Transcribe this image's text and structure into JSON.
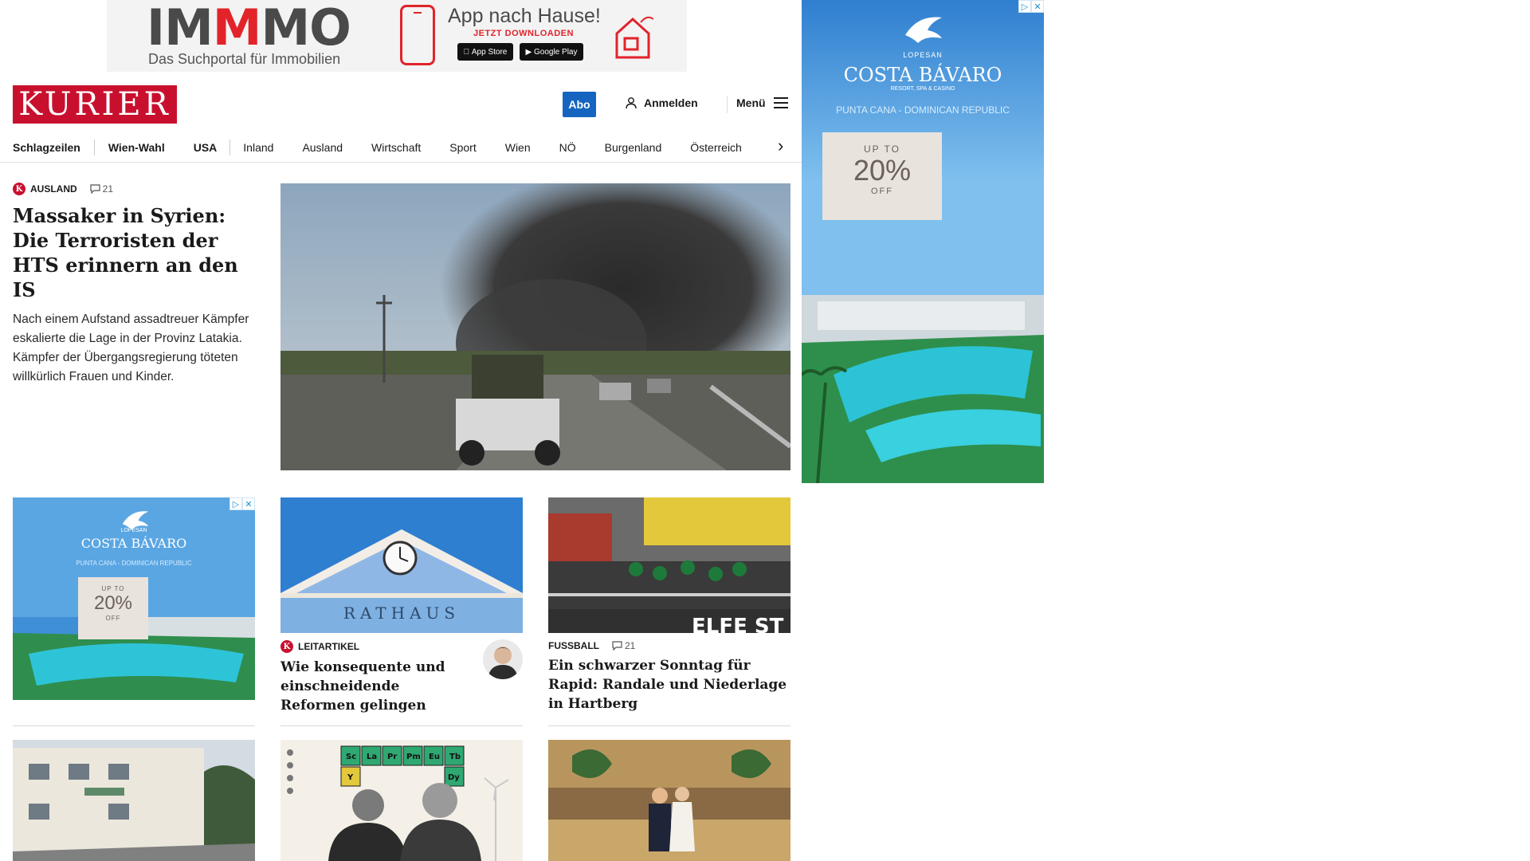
{
  "top_ad": {
    "brand_parts": [
      "IM",
      "M",
      "MO"
    ],
    "tagline": "Das Suchportal für Immobilien",
    "headline": "App nach Hause!",
    "cta": "JETZT DOWNLOADEN",
    "app_store": "App Store",
    "google_play": "Google Play"
  },
  "header": {
    "logo": "KURIER",
    "abo": "Abo",
    "login": "Anmelden",
    "menu": "Menü"
  },
  "nav": {
    "items": [
      "Schlagzeilen",
      "Wien-Wahl",
      "USA",
      "Inland",
      "Ausland",
      "Wirtschaft",
      "Sport",
      "Wien",
      "NÖ",
      "Burgenland",
      "Österreich"
    ]
  },
  "lead": {
    "badge": "K",
    "section": "Ausland",
    "comments": "21",
    "title": "Massaker in Syrien: Die Terroristen der HTS erinnern an den IS",
    "teaser": "Nach einem Aufstand assadtreuer Kämpfer eskalierte die Lage in der Provinz Latakia. Kämpfer der Übergangsregierung töteten willkürlich Frauen und Kinder."
  },
  "ad": {
    "brand_small": "LOPESAN",
    "brand": "COSTA BÁVARO",
    "sub": "RESORT, SPA & CASINO",
    "location": "PUNTA CANA - DOMINICAN REPUBLIC",
    "up_to": "UP TO",
    "discount": "20%",
    "off": "OFF"
  },
  "cards": [
    {
      "badge": "K",
      "section": "Leitartikel",
      "comments": "",
      "title": "Wie konsequente und einschneidende Reformen gelingen",
      "image_text": "RATHAUS"
    },
    {
      "badge": "",
      "section": "Fussball",
      "comments": "21",
      "title": "Ein schwarzer Sonntag für Rapid: Randale und Niederlage in Hartberg",
      "image_text": "ELFE ST"
    }
  ],
  "periodic": [
    "Sc",
    "La",
    "Pr",
    "Pm",
    "Eu",
    "Tb",
    "Y",
    "Dy"
  ],
  "colors": {
    "brand_red": "#c8102e",
    "abo_blue": "#1565c0",
    "ad_sky": "#3f8fd6"
  }
}
